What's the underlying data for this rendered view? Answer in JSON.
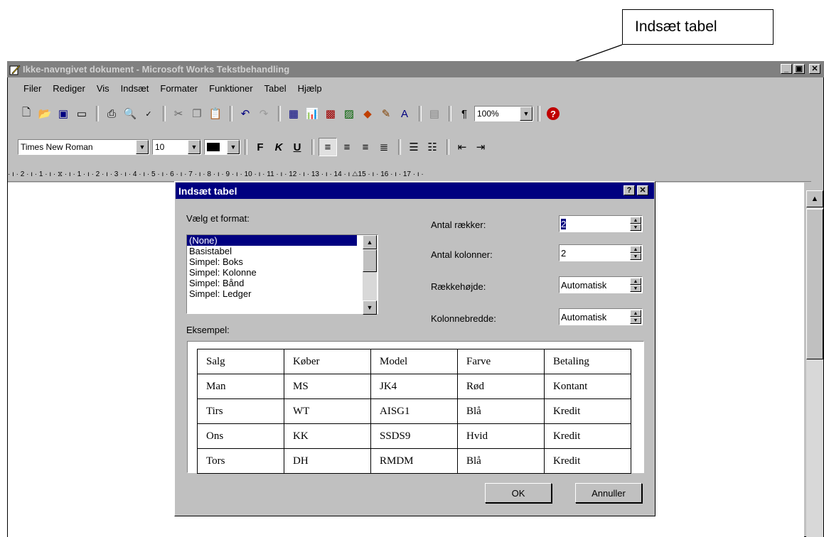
{
  "callout": {
    "label": "Indsæt tabel"
  },
  "window": {
    "title": "Ikke-navngivet dokument - Microsoft Works Tekstbehandling",
    "controls": {
      "minimize": "_",
      "maximize": "▣",
      "close": "✕"
    }
  },
  "menu": {
    "items": [
      "Filer",
      "Rediger",
      "Vis",
      "Indsæt",
      "Formater",
      "Funktioner",
      "Tabel",
      "Hjælp"
    ]
  },
  "toolbar": {
    "zoom": "100%",
    "help_icon": "?"
  },
  "format_toolbar": {
    "font": "Times New Roman",
    "size": "10",
    "bold": "F",
    "italic": "K",
    "underline": "U"
  },
  "ruler": {
    "text": "· ı · 2 · ı · 1 · ı · ⧖ · ı · 1 · ı · 2 · ı · 3 · ı · 4 · ı · 5 · ı · 6 · ı · 7 · ı · 8 · ı · 9 · ı · 10 · ı · 11 · ı · 12 · ı · 13 · ı · 14 · ı △15 · ı · 16 · ı · 17 · ı ·"
  },
  "dialog": {
    "title": "Indsæt tabel",
    "help": "?",
    "close": "✕",
    "format_label": "Vælg et format:",
    "formats": [
      "(None)",
      "Basistabel",
      "Simpel: Boks",
      "Simpel: Kolonne",
      "Simpel: Bånd",
      "Simpel: Ledger"
    ],
    "selected_format": "(None)",
    "rows_label": "Antal rækker:",
    "rows_value": "2",
    "cols_label": "Antal kolonner:",
    "cols_value": "2",
    "rowheight_label": "Rækkehøjde:",
    "rowheight_value": "Automatisk",
    "colwidth_label": "Kolonnebredde:",
    "colwidth_value": "Automatisk",
    "example_label": "Eksempel:",
    "example_table": [
      [
        "Salg",
        "Køber",
        "Model",
        "Farve",
        "Betaling"
      ],
      [
        "Man",
        "MS",
        "JK4",
        "Rød",
        "Kontant"
      ],
      [
        "Tirs",
        "WT",
        "AISG1",
        "Blå",
        "Kredit"
      ],
      [
        "Ons",
        "KK",
        "SSDS9",
        "Hvid",
        "Kredit"
      ],
      [
        "Tors",
        "DH",
        "RMDM",
        "Blå",
        "Kredit"
      ]
    ],
    "ok": "OK",
    "cancel": "Annuller"
  }
}
